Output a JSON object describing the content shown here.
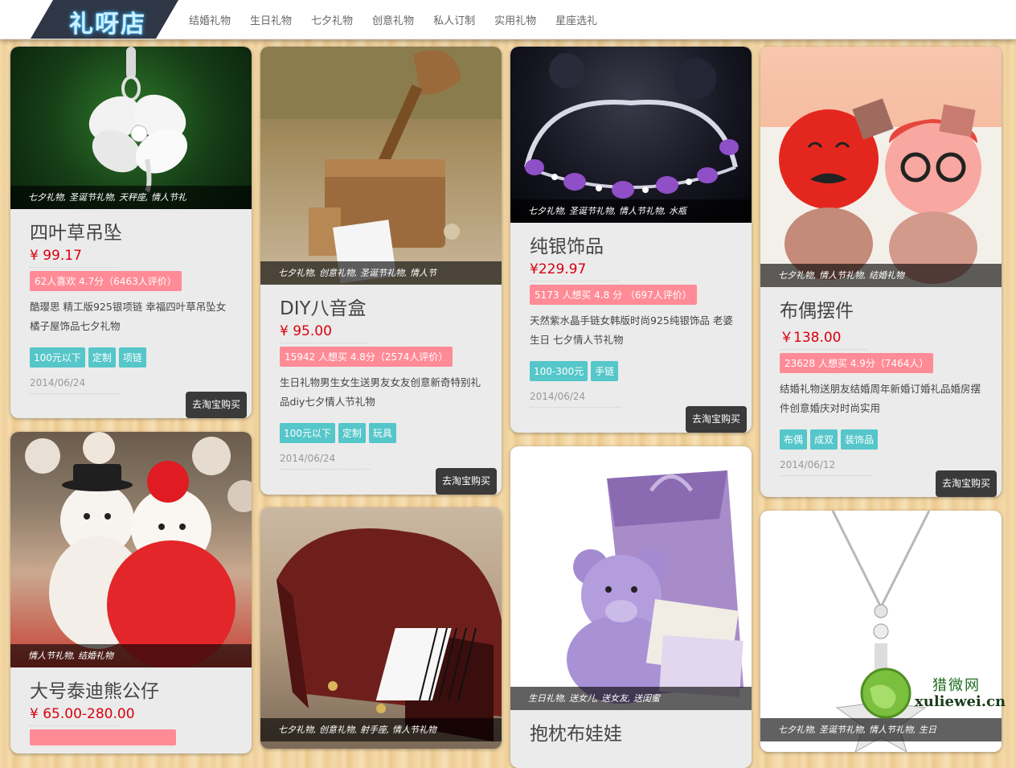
{
  "brand": {
    "logo_text": "礼呀店"
  },
  "nav": {
    "items": [
      "结婚礼物",
      "生日礼物",
      "七夕礼物",
      "创意礼物",
      "私人订制",
      "实用礼物",
      "星座选礼"
    ]
  },
  "buy_label": "去淘宝购买",
  "cards": [
    {
      "tags": "七夕礼物, 圣诞节礼物, 天秤座, 情人节礼",
      "title": "四叶草吊坠",
      "price": "¥ 99.17",
      "stat": "62人喜欢   4.7分（6463人评价）",
      "desc": "酷璎思 精工版925银项链 幸福四叶草吊坠女橘子屋饰品七夕礼物",
      "chips": [
        "100元以下",
        "定制",
        "项链"
      ],
      "date": "2014/06/24"
    },
    {
      "tags": "情人节礼物, 结婚礼物",
      "title": "大号泰迪熊公仔",
      "price": "¥ 65.00-280.00"
    },
    {
      "tags": "七夕礼物, 创意礼物, 圣诞节礼物, 情人节",
      "title": "DIY八音盒",
      "price": "¥ 95.00",
      "stat": "15942 人想买   4.8分（2574人评价）",
      "desc": "生日礼物男生女生送男友女友创意新奇特别礼品diy七夕情人节礼物",
      "chips": [
        "100元以下",
        "定制",
        "玩具"
      ],
      "date": "2014/06/24"
    },
    {
      "tags": "七夕礼物, 创意礼物, 射手座, 情人节礼物"
    },
    {
      "tags": "七夕礼物, 圣诞节礼物, 情人节礼物, 水瓶",
      "title": "纯银饰品",
      "price": "¥229.97",
      "stat": "5173 人想买   4.8 分 （697人评价）",
      "desc": "天然紫水晶手链女韩版时尚925纯银饰品 老婆生日 七夕情人节礼物",
      "chips": [
        "100-300元",
        "手链"
      ],
      "date": "2014/06/24"
    },
    {
      "tags": "生日礼物, 送女儿, 送女友, 送闺蜜",
      "title": "抱枕布娃娃"
    },
    {
      "tags": "七夕礼物, 情人节礼物, 结婚礼物",
      "title": "布偶摆件",
      "price": "￥138.00",
      "stat": "23628 人想买   4.9分（7464人）",
      "desc": "结婚礼物送朋友结婚周年新婚订婚礼品婚房摆件创意婚庆对时尚实用",
      "chips": [
        "布偶",
        "成双",
        "装饰品"
      ],
      "date": "2014/06/12"
    },
    {
      "tags": "七夕礼物, 圣诞节礼物, 情人节礼物, 生日"
    }
  ],
  "watermark": {
    "cn": "猎微网",
    "en": "xuliewei.cn"
  }
}
